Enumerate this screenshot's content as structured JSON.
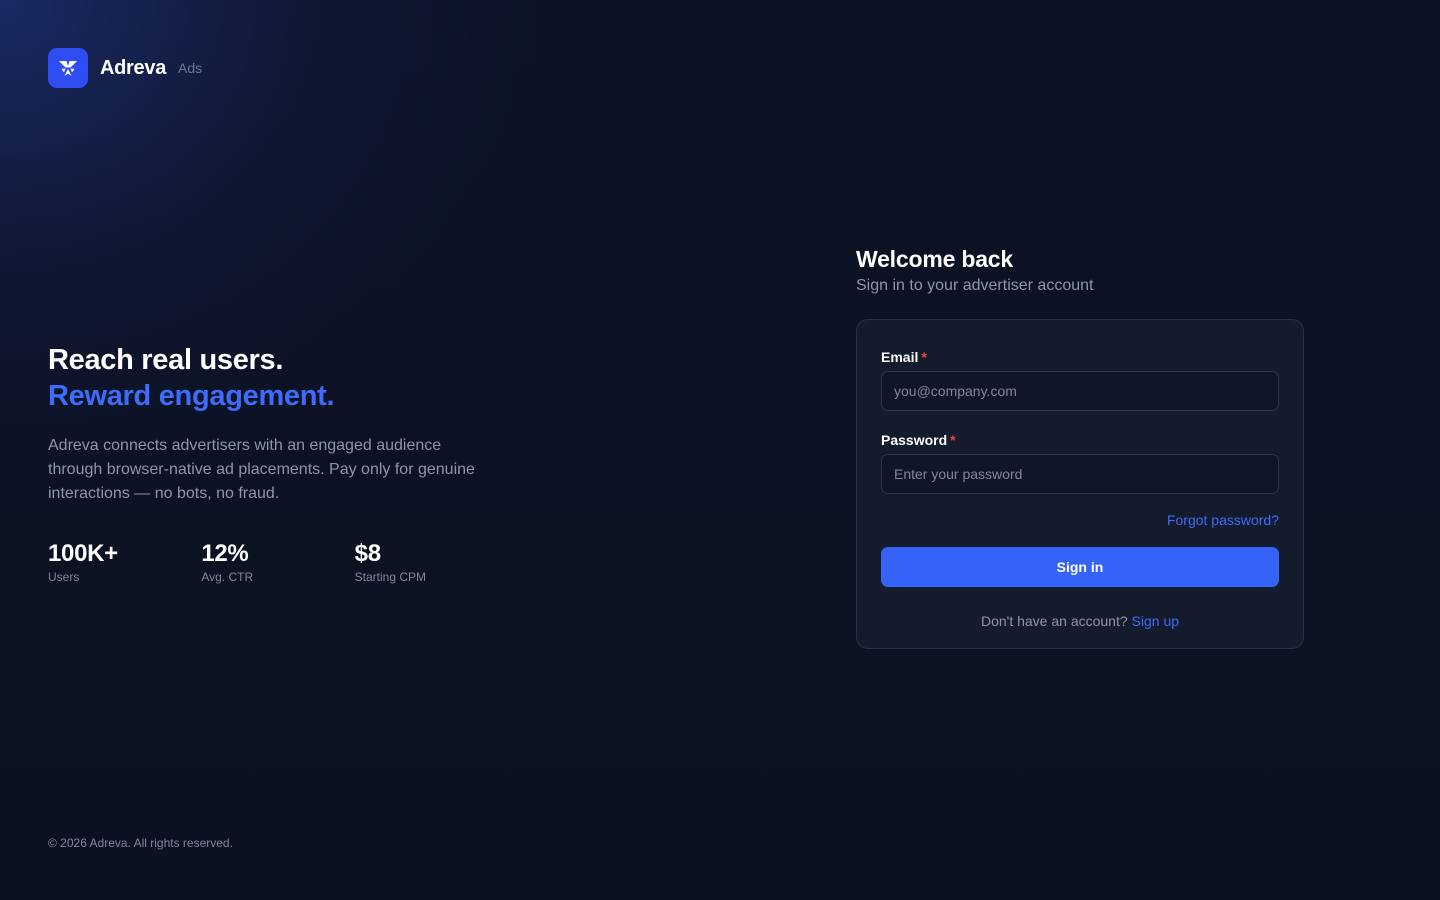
{
  "brand": {
    "name": "Adreva",
    "tag": "Ads",
    "logo_icon": "sparkle-logo-icon",
    "accent_color": "#2f4df2"
  },
  "hero": {
    "headline_line1": "Reach real users.",
    "headline_line2": "Reward engagement.",
    "description": "Adreva connects advertisers with an engaged audience through browser-native ad placements. Pay only for genuine interactions — no bots, no fraud.",
    "stats": [
      {
        "value": "100K+",
        "label": "Users"
      },
      {
        "value": "12%",
        "label": "Avg. CTR"
      },
      {
        "value": "$8",
        "label": "Starting CPM"
      }
    ]
  },
  "login": {
    "title": "Welcome back",
    "subtitle": "Sign in to your advertiser account",
    "email_label": "Email",
    "email_placeholder": "you@company.com",
    "email_value": "",
    "password_label": "Password",
    "password_placeholder": "Enter your password",
    "password_value": "",
    "required_marker": "*",
    "forgot_link": "Forgot password?",
    "signin_button": "Sign in",
    "signup_prompt": "Don't have an account?",
    "signup_link": "Sign up"
  },
  "footer": {
    "copyright": "© 2026 Adreva. All rights reserved."
  },
  "colors": {
    "background": "#0b1120",
    "primary": "#3563f7",
    "link": "#3d6bfa",
    "required": "#ef4444",
    "card": "#141b2d"
  }
}
